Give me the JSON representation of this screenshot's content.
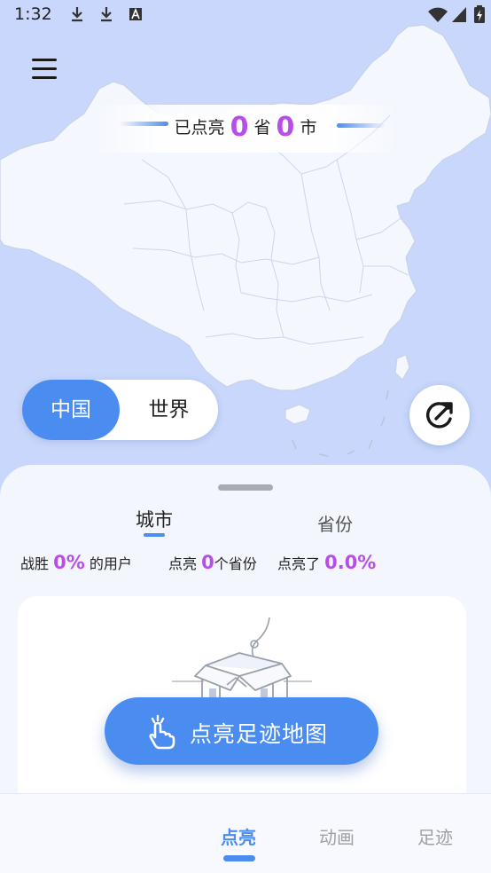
{
  "status_bar": {
    "time": "1:32"
  },
  "map": {
    "banner": {
      "prefix": "已点亮",
      "province_count": "0",
      "province_unit": "省",
      "city_count": "0",
      "city_unit": "市"
    }
  },
  "region_toggle": {
    "selected": "中国",
    "other": "世界"
  },
  "sheet": {
    "tabs": {
      "city": "城市",
      "province": "省份"
    },
    "stats": {
      "beat_prefix": "战胜",
      "beat_value": "0%",
      "beat_suffix": "的用户",
      "lit_prefix": "点亮",
      "lit_value": "0",
      "lit_suffix": "个省份",
      "lit_pct_prefix": "点亮了",
      "lit_pct_value": "0.0%"
    },
    "cta_label": "点亮足迹地图"
  },
  "bottom_nav": {
    "items": [
      "点亮",
      "动画",
      "足迹"
    ],
    "active": "点亮"
  },
  "colors": {
    "accent": "#4b8cf0",
    "highlight": "#b84ee8",
    "map_bg": "#c8d7fb",
    "land": "#f4f7fe"
  }
}
